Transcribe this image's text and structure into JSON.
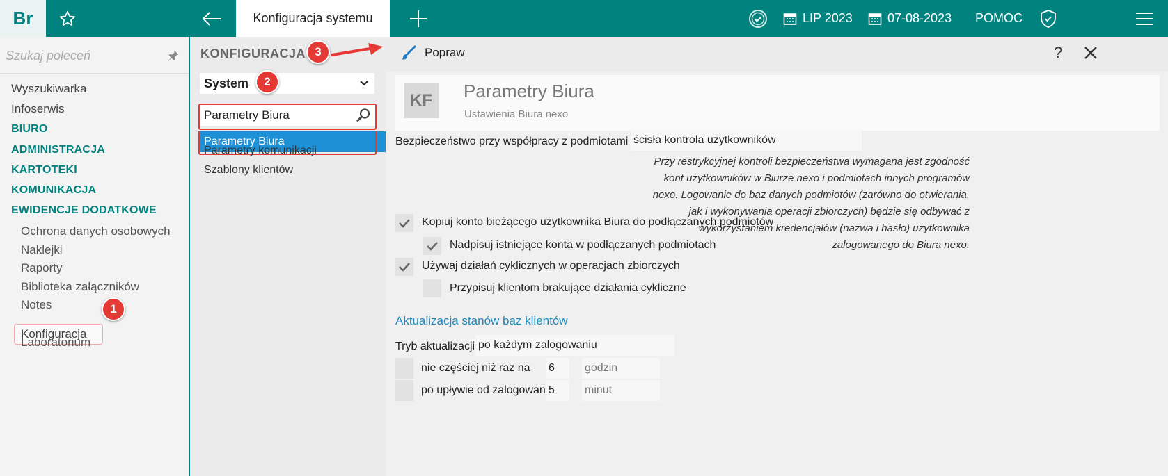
{
  "topbar": {
    "logo": "Br",
    "tab_title": "Konfiguracja systemu",
    "period": "LIP 2023",
    "date": "07-08-2023",
    "help": "POMOC",
    "icons": [
      "star-icon",
      "back-arrow-icon",
      "plus-icon",
      "check-circle-icon",
      "calendar-icon",
      "shield-icon",
      "hamburger-icon"
    ],
    "accent": "#00827f"
  },
  "sidebar": {
    "search_placeholder": "Szukaj poleceń",
    "items": [
      "Wyszukiwarka",
      "Infoserwis"
    ],
    "sections": [
      "BIURO",
      "ADMINISTRACJA",
      "KARTOTEKI",
      "KOMUNIKACJA",
      "EWIDENCJE DODATKOWE"
    ],
    "sub_items": [
      "Ochrona danych osobowych",
      "Naklejki",
      "Raporty",
      "Biblioteka załączników",
      "Notes",
      "Konfiguracja",
      "Laboratorium"
    ],
    "active": "Konfiguracja"
  },
  "middle": {
    "title": "KONFIGURACJA",
    "select_value": "System",
    "search_value": "Parametry Biura",
    "items": [
      "Parametry Biura",
      "Parametry komunikacji",
      "Szablony klientów"
    ],
    "selected_color": "#1e90d6"
  },
  "toolbar": {
    "edit_label": "Popraw",
    "help_label": "?"
  },
  "header": {
    "badge": "KF",
    "title": "Parametry Biura",
    "subtitle": "Ustawienia Biura nexo"
  },
  "form": {
    "security_label": "Bezpieczeństwo przy współpracy z podmiotami nexo:",
    "security_value": "ścisła kontrola użytkowników",
    "security_note": "Przy restrykcyjnej kontroli bezpieczeństwa wymagana jest zgodność kont użytkowników w Biurze nexo i podmiotach innych programów nexo. Logowanie do baz danych podmiotów (zarówno do otwierania, jak i wykonywania operacji zbiorczych) będzie się odbywać z wykorzystaniem kredencjałów (nazwa i hasło) użytkownika zalogowanego do Biura nexo.",
    "checkboxes": [
      {
        "label": "Kopiuj konto bieżącego użytkownika Biura do podłączanych podmiotów",
        "checked": true
      },
      {
        "label": "Nadpisuj istniejące konta w podłączanych podmiotach",
        "checked": true
      },
      {
        "label": "Używaj działań cyklicznych w operacjach zbiorczych",
        "checked": true
      },
      {
        "label": "Przypisuj klientom brakujące działania cykliczne",
        "checked": false
      }
    ],
    "update_section_title": "Aktualizacja stanów baz klientów",
    "mode_label": "Tryb aktualizacji:",
    "mode_value": "po każdym zalogowaniu",
    "rows": [
      {
        "label": "nie częściej niż raz na",
        "value": "6",
        "unit": "godzin",
        "checked": false
      },
      {
        "label": "po upływie od zalogowania",
        "value": "5",
        "unit": "minut",
        "checked": false
      }
    ]
  },
  "annotations": [
    "1",
    "2",
    "3"
  ]
}
